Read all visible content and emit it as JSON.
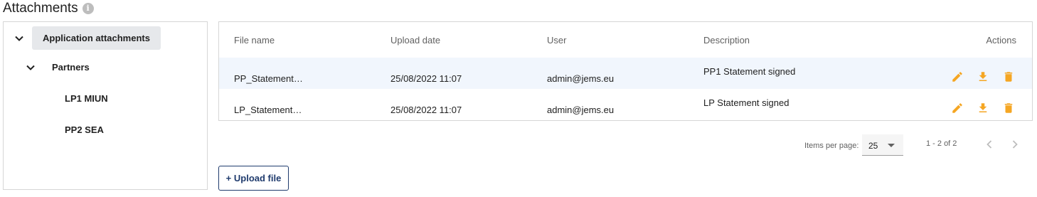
{
  "section": {
    "title": "Attachments",
    "info_glyph": "i"
  },
  "tree": {
    "root": {
      "label": "Application attachments",
      "expanded": true
    },
    "partners": {
      "label": "Partners",
      "expanded": true
    },
    "children": [
      {
        "label": "LP1 MIUN"
      },
      {
        "label": "PP2 SEA"
      }
    ]
  },
  "table": {
    "columns": [
      "File name",
      "Upload date",
      "User",
      "Description",
      "Actions"
    ],
    "rows": [
      {
        "file_name": "PP_Statement…",
        "upload_date": "25/08/2022 11:07",
        "user": "admin@jems.eu",
        "description": "PP1 Statement signed"
      },
      {
        "file_name": "LP_Statement…",
        "upload_date": "25/08/2022 11:07",
        "user": "admin@jems.eu",
        "description": "LP Statement signed"
      }
    ],
    "action_icons": [
      "edit-icon",
      "download-icon",
      "delete-icon"
    ]
  },
  "paginator": {
    "items_per_page_label": "Items per page:",
    "items_per_page_value": "25",
    "range_label": "1 - 2 of 2"
  },
  "upload_button_label": "+ Upload file",
  "colors": {
    "accent_orange": "#f5a623",
    "primary_navy": "#1f3b6d",
    "selected_row": "#f1f6fd",
    "tree_pill": "#e6e8eb"
  }
}
